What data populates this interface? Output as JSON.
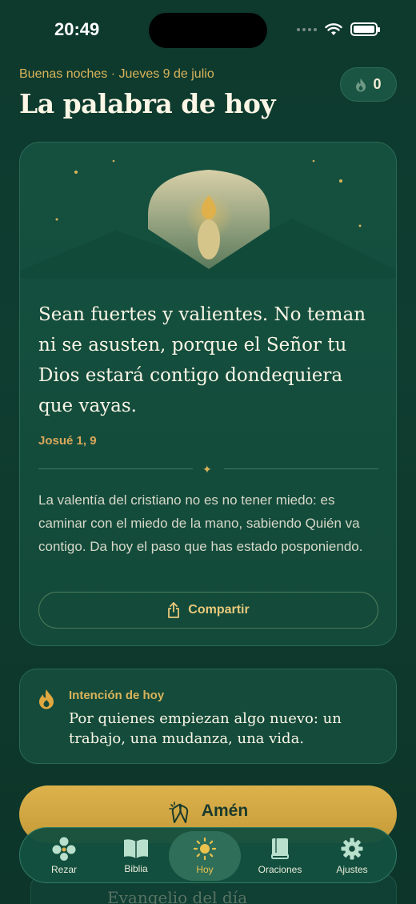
{
  "status_bar": {
    "time": "20:49"
  },
  "header": {
    "greeting": "Buenas noches · Jueves 9 de julio",
    "title": "La palabra de hoy",
    "streak_count": "0"
  },
  "verse_card": {
    "verse": "Sean fuertes y valientes. No teman ni se asusten, porque el Señor tu Dios estará contigo dondequiera que vayas.",
    "reference": "Josué 1, 9",
    "reflection": "La valentía del cristiano no es no tener miedo: es caminar con el miedo de la mano, sabiendo Quién va contigo. Da hoy el paso que has estado posponiendo.",
    "share_label": "Compartir"
  },
  "intention": {
    "label": "Intención de hoy",
    "text": "Por quienes empiezan algo nuevo: un trabajo, una mudanza, una vida."
  },
  "amen_button": {
    "label": "Amén"
  },
  "next_card": {
    "title": "Evangelio del día"
  },
  "tab_bar": {
    "items": [
      {
        "label": "Rezar",
        "icon": "rosary-icon"
      },
      {
        "label": "Biblia",
        "icon": "open-book-icon"
      },
      {
        "label": "Hoy",
        "icon": "sun-icon",
        "active": true
      },
      {
        "label": "Oraciones",
        "icon": "prayer-book-icon"
      },
      {
        "label": "Ajustes",
        "icon": "gear-icon"
      }
    ]
  },
  "colors": {
    "background": "#0e3a2e",
    "accent_gold": "#d9b35a",
    "button_gold": "#ddb24d",
    "card": "#15503f"
  }
}
